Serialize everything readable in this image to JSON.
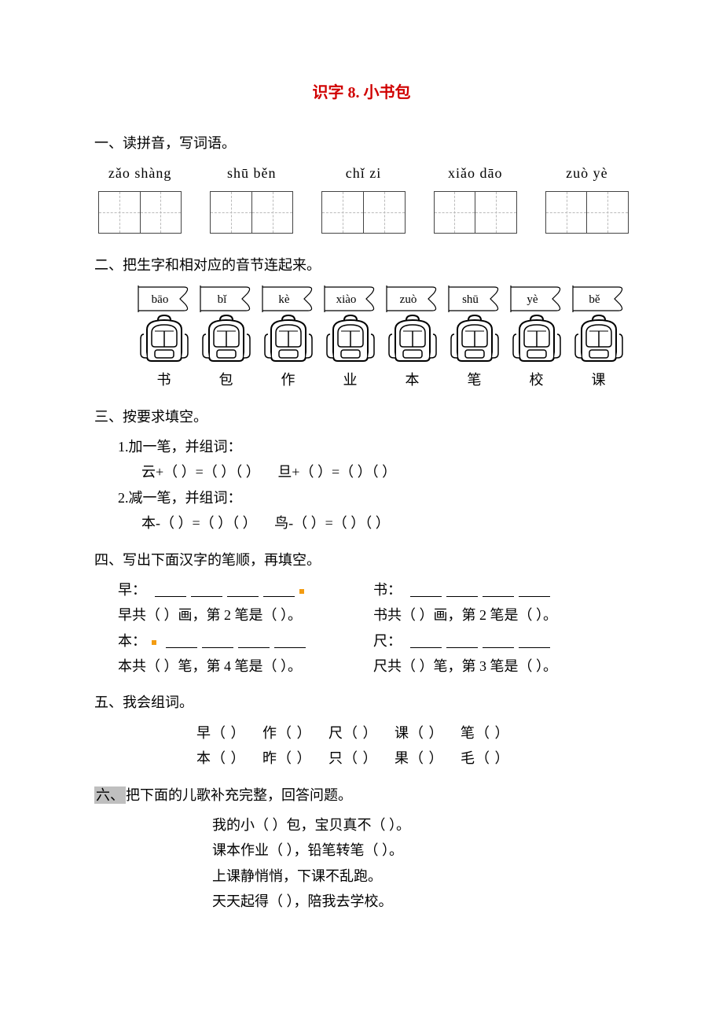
{
  "title": "识字 8. 小书包",
  "sec1": {
    "heading": "一、读拼音，写词语。",
    "pinyins": [
      "zǎo shàng",
      "shū běn",
      "chǐ zi",
      "xiǎo dāo",
      "zuò yè"
    ]
  },
  "sec2": {
    "heading": "二、把生字和相对应的音节连起来。",
    "flags": [
      "bāo",
      "bǐ",
      "kè",
      "xiào",
      "zuò",
      "shū",
      "yè",
      "bě"
    ],
    "chars": [
      "书",
      "包",
      "作",
      "业",
      "本",
      "笔",
      "校",
      "课"
    ]
  },
  "sec3": {
    "heading": "三、按要求填空。",
    "line1": "1.加一笔，并组词：",
    "line1a_left": "云+（    ）=（    ）（        ）",
    "line1a_right": "旦+（    ）=（    ）（        ）",
    "line2": "2.减一笔，并组词：",
    "line2a_left": "本-（    ）=（    ）（        ）",
    "line2a_right": "鸟-（    ）=（    ）（        ）"
  },
  "sec4": {
    "heading": "四、写出下面汉字的笔顺，再填空。",
    "zao": "早：",
    "zao_q": "早共（     ）画，第 2 笔是（    ）。",
    "shu": "书：",
    "shu_q": "书共（    ）画，第 2 笔是（    ）。",
    "ben": "本：",
    "ben_q": "本共（    ）笔，第 4 笔是（    ）。",
    "chi": "尺：",
    "chi_q": "尺共（    ）笔，第 3 笔是（    ）。"
  },
  "sec5": {
    "heading": "五、我会组词。",
    "row1": [
      "早（      ）",
      "作（      ）",
      "尺（      ）",
      "课（      ）",
      "笔（      ）"
    ],
    "row2": [
      "本（      ）",
      "昨（      ）",
      "只（      ）",
      "果（      ）",
      "毛（      ）"
    ]
  },
  "sec6": {
    "prefix": "六、",
    "heading_rest": "把下面的儿歌补充完整，回答问题。",
    "lines": [
      "我的小（      ）包，宝贝真不（      ）。",
      "课本作业（      ），铅笔转笔（      ）。",
      "上课静悄悄，下课不乱跑。",
      "天天起得（      ），陪我去学校。"
    ]
  }
}
